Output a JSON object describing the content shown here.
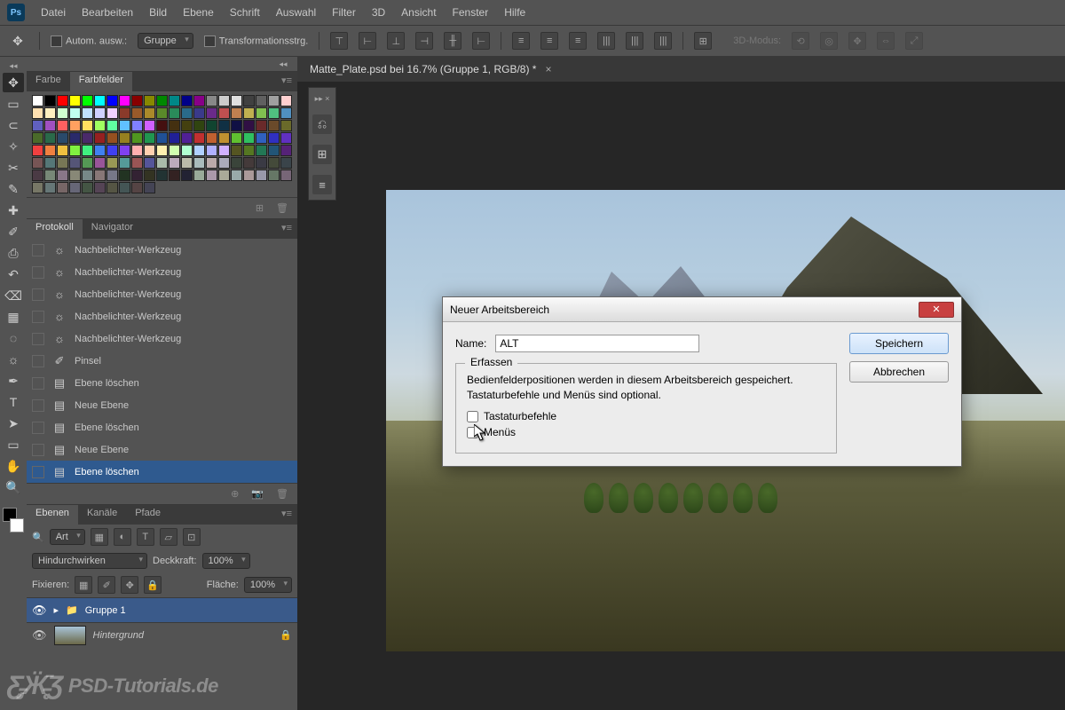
{
  "app": {
    "logo": "Ps"
  },
  "menu": [
    "Datei",
    "Bearbeiten",
    "Bild",
    "Ebene",
    "Schrift",
    "Auswahl",
    "Filter",
    "3D",
    "Ansicht",
    "Fenster",
    "Hilfe"
  ],
  "options": {
    "auto_select": "Autom. ausw.:",
    "group": "Gruppe",
    "transform_ctrl": "Transformationsstrg.",
    "mode3d": "3D-Modus:"
  },
  "doc_tab": {
    "title": "Matte_Plate.psd bei 16.7% (Gruppe 1, RGB/8) *"
  },
  "panels": {
    "color": {
      "tab_color": "Farbe",
      "tab_swatches": "Farbfelder"
    },
    "history": {
      "tab_history": "Protokoll",
      "tab_navigator": "Navigator",
      "items": [
        {
          "icon": "burn",
          "label": "Nachbelichter-Werkzeug"
        },
        {
          "icon": "burn",
          "label": "Nachbelichter-Werkzeug"
        },
        {
          "icon": "burn",
          "label": "Nachbelichter-Werkzeug"
        },
        {
          "icon": "burn",
          "label": "Nachbelichter-Werkzeug"
        },
        {
          "icon": "burn",
          "label": "Nachbelichter-Werkzeug"
        },
        {
          "icon": "brush",
          "label": "Pinsel"
        },
        {
          "icon": "layer",
          "label": "Ebene löschen"
        },
        {
          "icon": "layer",
          "label": "Neue Ebene"
        },
        {
          "icon": "layer",
          "label": "Ebene löschen"
        },
        {
          "icon": "layer",
          "label": "Neue Ebene"
        },
        {
          "icon": "layer",
          "label": "Ebene löschen"
        }
      ]
    },
    "layers": {
      "tab_layers": "Ebenen",
      "tab_channels": "Kanäle",
      "tab_paths": "Pfade",
      "filter_kind": "Art",
      "blend": "Hindurchwirken",
      "opacity_lbl": "Deckkraft:",
      "opacity_val": "100%",
      "lock_lbl": "Fixieren:",
      "fill_lbl": "Fläche:",
      "fill_val": "100%",
      "group": "Gruppe 1",
      "bg": "Hintergrund"
    }
  },
  "dialog": {
    "title": "Neuer Arbeitsbereich",
    "name_lbl": "Name:",
    "name_val": "ALT",
    "capture_legend": "Erfassen",
    "capture_help": "Bedienfelderpositionen werden in diesem Arbeitsbereich gespeichert. Tastaturbefehle und Menüs sind optional.",
    "chk_shortcuts": "Tastaturbefehle",
    "chk_menus": "Menüs",
    "save": "Speichern",
    "cancel": "Abbrechen"
  },
  "watermark": "PSD-Tutorials.de",
  "swatch_colors": [
    "#fff",
    "#000",
    "#f00",
    "#ff0",
    "#0f0",
    "#0ff",
    "#00f",
    "#f0f",
    "#800",
    "#880",
    "#080",
    "#088",
    "#008",
    "#808",
    "#888",
    "#ccc",
    "#e0e0e0",
    "#404040",
    "#606060",
    "#a0a0a0",
    "#ffd0d0",
    "#ffe0b0",
    "#fff0c0",
    "#d0ffd0",
    "#c0fff0",
    "#c0e0ff",
    "#d0d0ff",
    "#f0d0ff",
    "#8a3a2a",
    "#9a5a2a",
    "#aa8a2a",
    "#5a8a2a",
    "#2a8a5a",
    "#2a6a8a",
    "#3a3a8a",
    "#6a2a8a",
    "#c05050",
    "#c08050",
    "#c0b050",
    "#80c050",
    "#50c080",
    "#5090c0",
    "#6060c0",
    "#a050c0",
    "#ff6060",
    "#ffa060",
    "#ffe060",
    "#a0ff60",
    "#60ffa0",
    "#60c0ff",
    "#8080ff",
    "#d060ff",
    "#441010",
    "#443010",
    "#444010",
    "#304410",
    "#104430",
    "#103044",
    "#101044",
    "#301044",
    "#6a2a2a",
    "#6a4a2a",
    "#6a6a2a",
    "#4a6a2a",
    "#2a6a4a",
    "#2a4a6a",
    "#2a2a6a",
    "#4a2a6a",
    "#962020",
    "#965020",
    "#968020",
    "#509620",
    "#209650",
    "#205096",
    "#202096",
    "#502096",
    "#c03030",
    "#c06030",
    "#c09030",
    "#60c030",
    "#30c060",
    "#3060c0",
    "#3030c0",
    "#6030c0",
    "#f04040",
    "#f08040",
    "#f0c040",
    "#80f040",
    "#40f080",
    "#4080f0",
    "#4040f0",
    "#8040f0",
    "#ffb0b0",
    "#ffd0b0",
    "#fff0b0",
    "#d0ffb0",
    "#b0ffd0",
    "#b0d0ff",
    "#b0b0ff",
    "#d0b0ff",
    "#552",
    "#572",
    "#275",
    "#257",
    "#527",
    "#755",
    "#577",
    "#775",
    "#557",
    "#595",
    "#959",
    "#995",
    "#599",
    "#955",
    "#559",
    "#aba",
    "#bab",
    "#bba",
    "#abb",
    "#baa",
    "#aab",
    "#3a443a",
    "#443a3a",
    "#3a3a44",
    "#444a3a",
    "#3a444a",
    "#4a3a44",
    "#787",
    "#878",
    "#887",
    "#788",
    "#877",
    "#778",
    "#232",
    "#323",
    "#332",
    "#233",
    "#322",
    "#223",
    "#9a9",
    "#a9a",
    "#aa9",
    "#9aa",
    "#a99",
    "#99a",
    "#676",
    "#767",
    "#776",
    "#677",
    "#766",
    "#667",
    "#454",
    "#545",
    "#554",
    "#455",
    "#544",
    "#445"
  ]
}
